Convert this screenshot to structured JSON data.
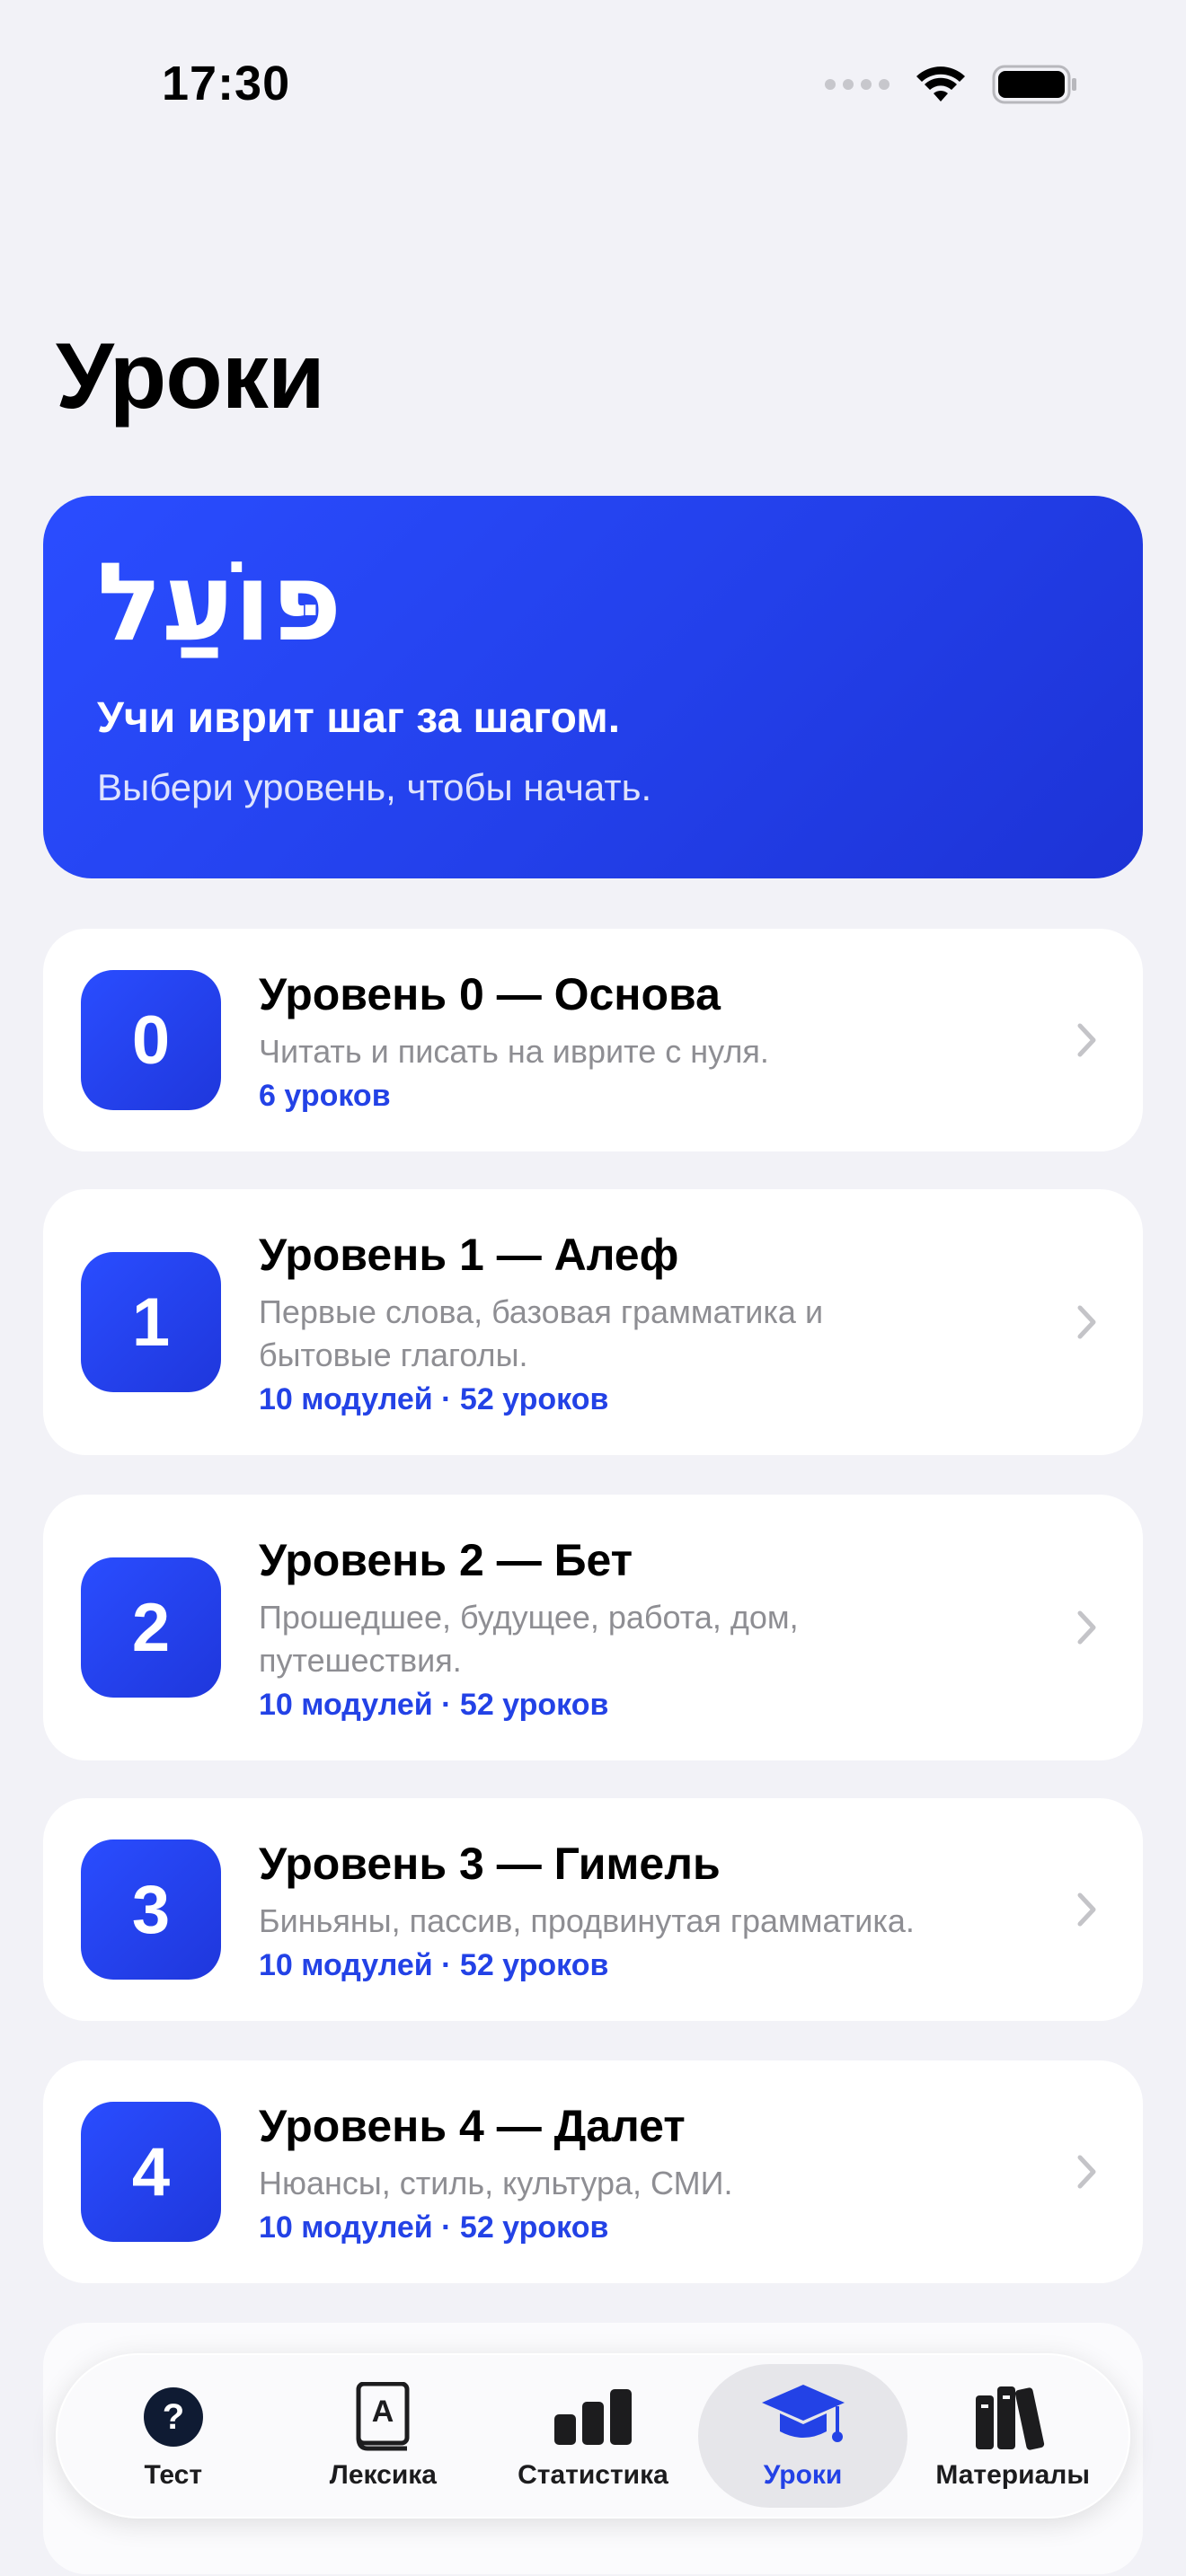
{
  "status_bar": {
    "time": "17:30"
  },
  "page": {
    "title": "Уроки"
  },
  "hero": {
    "logo": "פּוֹעַל",
    "tagline": "Учи иврит шаг за шагом.",
    "subtitle": "Выбери уровень, чтобы начать."
  },
  "levels": [
    {
      "number": "0",
      "title": "Уровень 0 — Основа",
      "description": "Читать и писать на иврите с нуля.",
      "meta": "6 уроков"
    },
    {
      "number": "1",
      "title": "Уровень 1 — Алеф",
      "description": "Первые слова, базовая грамматика и бытовые глаголы.",
      "meta": "10 модулей · 52 уроков"
    },
    {
      "number": "2",
      "title": "Уровень 2 — Бет",
      "description": "Прошедшее, будущее, работа, дом, путешествия.",
      "meta": "10 модулей · 52 уроков"
    },
    {
      "number": "3",
      "title": "Уровень 3 — Гимель",
      "description": "Биньяны, пассив, продвинутая грамматика.",
      "meta": "10 модулей · 52 уроков"
    },
    {
      "number": "4",
      "title": "Уровень 4 — Далет",
      "description": "Нюансы, стиль, культура, СМИ.",
      "meta": "10 модулей · 52 уроков"
    }
  ],
  "tabs": [
    {
      "label": "Тест",
      "icon": "question-circle-icon",
      "active": false
    },
    {
      "label": "Лексика",
      "icon": "dictionary-icon",
      "active": false
    },
    {
      "label": "Статистика",
      "icon": "bar-chart-icon",
      "active": false
    },
    {
      "label": "Уроки",
      "icon": "graduation-cap-icon",
      "active": true
    },
    {
      "label": "Материалы",
      "icon": "books-icon",
      "active": false
    }
  ],
  "colors": {
    "accent": "#2342E6",
    "background": "#F2F2F7"
  }
}
